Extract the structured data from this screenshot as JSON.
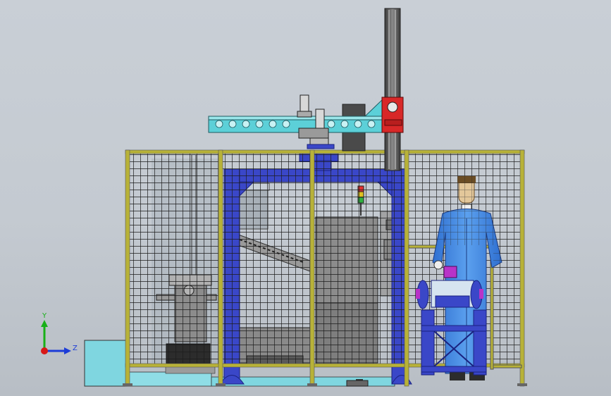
{
  "triad": {
    "y_label": "Y",
    "z_label": "Z",
    "y_color": "#18b018",
    "z_color": "#1c3cd8",
    "x_color": "#d81818"
  },
  "colors": {
    "fence": "#b8b238",
    "mesh": "#1c1c1c",
    "frame_blue": "#3a47c8",
    "cyan": "#5cd0d8",
    "red": "#d82828",
    "pillar": "#5a5a5a",
    "machine_grey": "#8c8c8c",
    "background": "#c4cad1"
  },
  "icons": [
    "axis-triad-icon"
  ]
}
